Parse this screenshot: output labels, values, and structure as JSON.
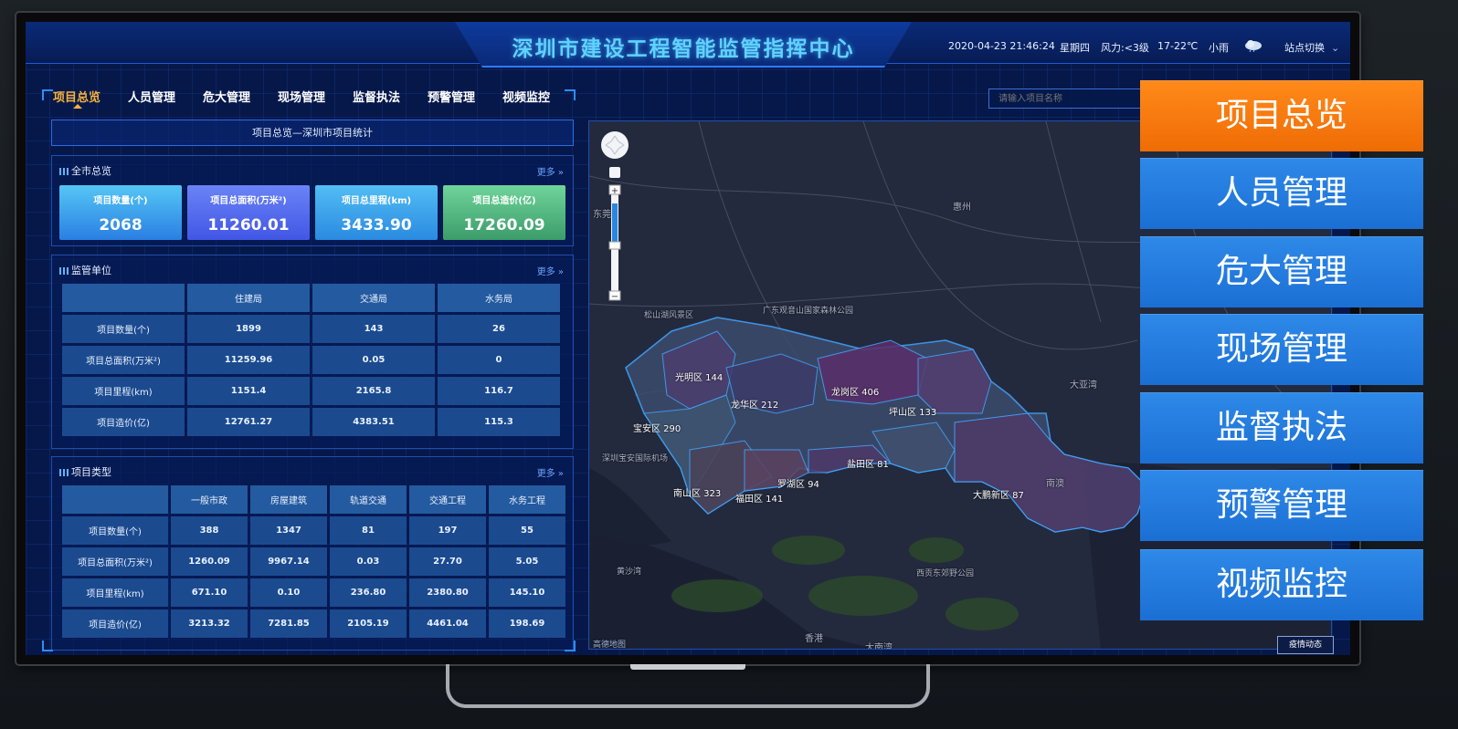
{
  "header": {
    "title": "深圳市建设工程智能监管指挥中心",
    "datetime": "2020-04-23 21:46:24",
    "weekday": "星期四",
    "wind": "风力:<3级",
    "temp": "17-22℃",
    "weather": "小雨",
    "site_switch": "站点切换",
    "weather_icon": "cloud-rain-icon"
  },
  "nav": {
    "items": [
      {
        "label": "项目总览",
        "active": true
      },
      {
        "label": "人员管理"
      },
      {
        "label": "危大管理"
      },
      {
        "label": "现场管理"
      },
      {
        "label": "监督执法"
      },
      {
        "label": "预警管理"
      },
      {
        "label": "视频监控"
      }
    ]
  },
  "panel_title": "项目总览—深圳市项目统计",
  "overview": {
    "title": "全市总览",
    "more": "更多",
    "cards": [
      {
        "label": "项目数量(个)",
        "value": "2068"
      },
      {
        "label": "项目总面积(万米²)",
        "value": "11260.01"
      },
      {
        "label": "项目总里程(km)",
        "value": "3433.90"
      },
      {
        "label": "项目总造价(亿)",
        "value": "17260.09"
      }
    ]
  },
  "supervisors": {
    "title": "监管单位",
    "more": "更多",
    "columns": [
      "",
      "住建局",
      "交通局",
      "水务局"
    ],
    "rows": [
      [
        "项目数量(个)",
        "1899",
        "143",
        "26"
      ],
      [
        "项目总面积(万米²)",
        "11259.96",
        "0.05",
        "0"
      ],
      [
        "项目里程(km)",
        "1151.4",
        "2165.8",
        "116.7"
      ],
      [
        "项目造价(亿)",
        "12761.27",
        "4383.51",
        "115.3"
      ]
    ]
  },
  "types": {
    "title": "项目类型",
    "more": "更多",
    "columns": [
      "",
      "一般市政",
      "房屋建筑",
      "轨道交通",
      "交通工程",
      "水务工程"
    ],
    "rows": [
      [
        "项目数量(个)",
        "388",
        "1347",
        "81",
        "197",
        "55"
      ],
      [
        "项目总面积(万米²)",
        "1260.09",
        "9967.14",
        "0.03",
        "27.70",
        "5.05"
      ],
      [
        "项目里程(km)",
        "671.10",
        "0.10",
        "236.80",
        "2380.80",
        "145.10"
      ],
      [
        "项目造价(亿)",
        "3213.32",
        "7281.85",
        "2105.19",
        "4461.04",
        "198.69"
      ]
    ]
  },
  "search": {
    "placeholder": "请输入项目名称"
  },
  "map": {
    "districts": [
      {
        "label": "光明区 144"
      },
      {
        "label": "龙华区 212"
      },
      {
        "label": "龙岗区 406"
      },
      {
        "label": "宝安区 290"
      },
      {
        "label": "坪山区 133"
      },
      {
        "label": "盐田区 81"
      },
      {
        "label": "罗湖区 94"
      },
      {
        "label": "南山区 323"
      },
      {
        "label": "福田区 141"
      },
      {
        "label": "大鹏新区 87"
      }
    ],
    "places": [
      "惠州",
      "东莞",
      "大亚湾",
      "南澳",
      "香港",
      "大南湾",
      "西贡东郊野公园",
      "松山湖风景区",
      "广东观音山国家森林公园",
      "深圳宝安国际机场",
      "黄沙湾"
    ],
    "epidemic_button": "疫情动态",
    "map_brand": "高德地图"
  },
  "big_buttons": [
    {
      "label": "项目总览",
      "active": true
    },
    {
      "label": "人员管理"
    },
    {
      "label": "危大管理"
    },
    {
      "label": "现场管理"
    },
    {
      "label": "监督执法"
    },
    {
      "label": "预警管理"
    },
    {
      "label": "视频监控"
    }
  ],
  "colors": {
    "accent_orange": "#ef6c05",
    "button_blue": "#1b6fd4",
    "title_cyan": "#5fd2ff",
    "screen_bg": "#06184a"
  }
}
